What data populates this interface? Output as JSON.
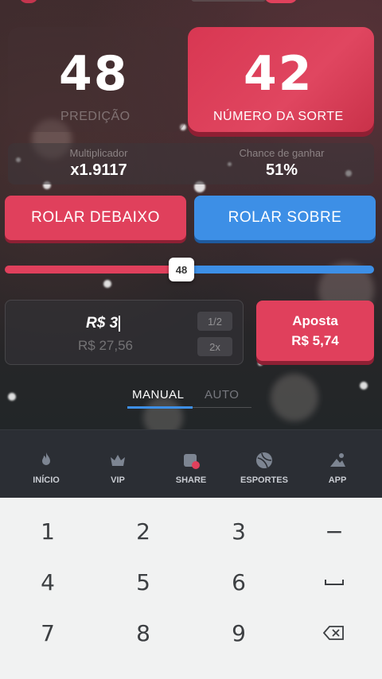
{
  "result": {
    "prediction_value": "48",
    "prediction_label": "PREDIÇÃO",
    "lucky_value": "42",
    "lucky_label": "NÚMERO DA SORTE"
  },
  "stats": {
    "multiplier_label": "Multiplicador",
    "multiplier_value": "x1.9117",
    "chance_label": "Chance de ganhar",
    "chance_value": "51%"
  },
  "actions": {
    "roll_under_label": "ROLAR DEBAIXO",
    "roll_over_label": "ROLAR SOBRE"
  },
  "slider": {
    "value": "48",
    "fraction": 0.48
  },
  "bet": {
    "amount": "R$ 3",
    "balance": "R$ 27,56",
    "half_label": "1/2",
    "double_label": "2x",
    "submit_line1": "Aposta",
    "submit_line2": "R$ 5,74"
  },
  "mode_tabs": {
    "manual": "MANUAL",
    "auto": "AUTO",
    "active": "manual"
  },
  "bottom_nav": {
    "items": [
      {
        "label": "INÍCIO",
        "icon": "flame-icon"
      },
      {
        "label": "VIP",
        "icon": "crown-icon"
      },
      {
        "label": "SHARE",
        "icon": "share-icon"
      },
      {
        "label": "ESPORTES",
        "icon": "ball-icon"
      },
      {
        "label": "APP",
        "icon": "app-icon"
      }
    ]
  },
  "keypad": {
    "rows": [
      [
        "1",
        "2",
        "3",
        "−"
      ],
      [
        "4",
        "5",
        "6",
        "space-key-icon"
      ],
      [
        "7",
        "8",
        "9",
        "backspace-icon"
      ]
    ]
  },
  "colors": {
    "accent_red": "#e0405c",
    "accent_blue": "#3d8fe6",
    "nav_bg": "#2b2e34",
    "keypad_bg": "#f1f2f2"
  }
}
